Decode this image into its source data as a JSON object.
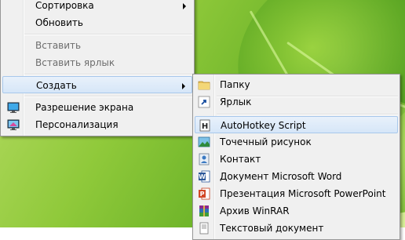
{
  "menu": {
    "items": [
      {
        "label": "Сортировка"
      },
      {
        "label": "Обновить"
      },
      {
        "label": "Вставить"
      },
      {
        "label": "Вставить ярлык"
      },
      {
        "label": "Создать"
      },
      {
        "label": "Разрешение экрана"
      },
      {
        "label": "Персонализация"
      }
    ]
  },
  "submenu": {
    "items": [
      {
        "label": "Папку",
        "icon": "folder-icon"
      },
      {
        "label": "Ярлык",
        "icon": "shortcut-icon"
      },
      {
        "label": "AutoHotkey Script",
        "icon": "autohotkey-icon"
      },
      {
        "label": "Точечный рисунок",
        "icon": "bitmap-icon"
      },
      {
        "label": "Контакт",
        "icon": "contact-icon"
      },
      {
        "label": "Документ Microsoft Word",
        "icon": "word-icon"
      },
      {
        "label": "Презентация Microsoft PowerPoint",
        "icon": "powerpoint-icon"
      },
      {
        "label": "Архив WinRAR",
        "icon": "winrar-icon"
      },
      {
        "label": "Текстовый документ",
        "icon": "text-document-icon"
      }
    ]
  },
  "colors": {
    "highlight": "#d6e6f8",
    "highlight_border": "#a8c8ec",
    "menu_bg": "#f0f0f0"
  }
}
